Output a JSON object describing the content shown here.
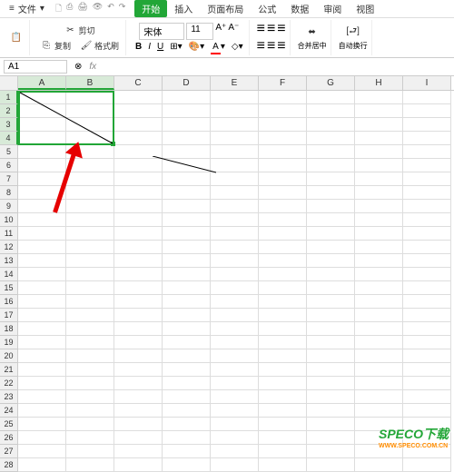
{
  "file_menu": "文件",
  "tabs": [
    "开始",
    "插入",
    "页面布局",
    "公式",
    "数据",
    "审阅",
    "视图"
  ],
  "active_tab": 0,
  "ribbon": {
    "cut": "剪切",
    "copy": "复制",
    "format_painter": "格式刷",
    "font_name": "宋体",
    "font_size": "11",
    "merge_center": "合并居中",
    "auto_wrap": "自动换行"
  },
  "namebox": "A1",
  "fx": "fx",
  "columns": [
    "A",
    "B",
    "C",
    "D",
    "E",
    "F",
    "G",
    "H",
    "I"
  ],
  "row_count": 28,
  "selected_cols": [
    "A",
    "B"
  ],
  "selected_rows": [
    1,
    2,
    3,
    4
  ],
  "watermark": {
    "brand": "SPECO下载",
    "url": "WWW.SPECO.COM.CN"
  }
}
